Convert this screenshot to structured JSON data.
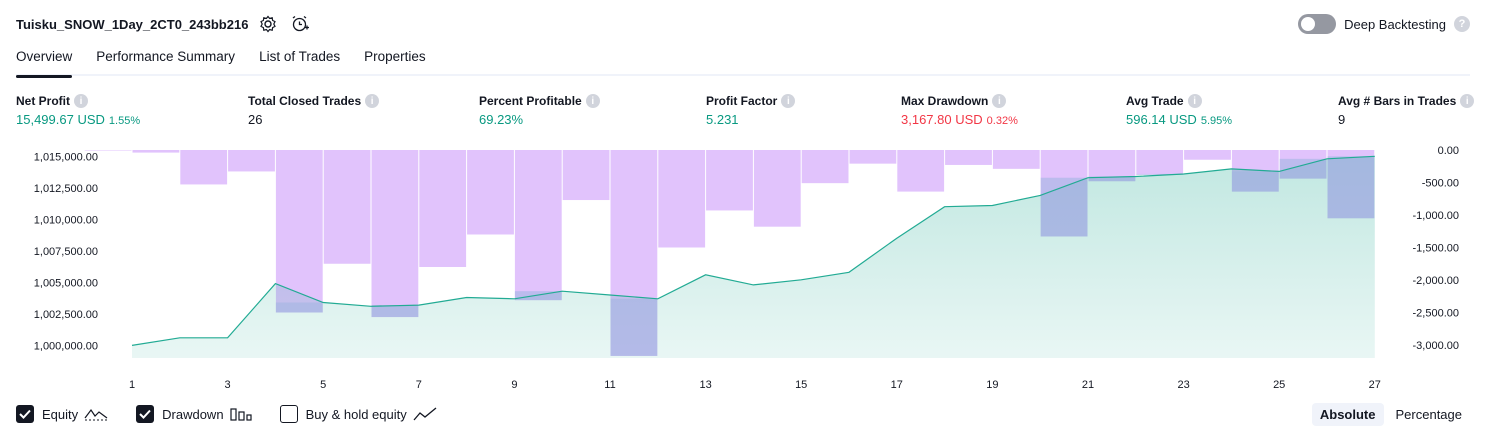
{
  "header": {
    "strategy_name": "Tuisku_SNOW_1Day_2CT0_243bb216",
    "deep_backtesting_label": "Deep Backtesting",
    "icons": [
      "settings-icon",
      "alert-add-icon",
      "help-icon"
    ]
  },
  "tabs": [
    {
      "label": "Overview",
      "active": true
    },
    {
      "label": "Performance Summary",
      "active": false
    },
    {
      "label": "List of Trades",
      "active": false
    },
    {
      "label": "Properties",
      "active": false
    }
  ],
  "metrics": [
    {
      "label": "Net Profit",
      "value": "15,499.67 USD",
      "pct": "1.55%",
      "tone": "pos"
    },
    {
      "label": "Total Closed Trades",
      "value": "26",
      "pct": "",
      "tone": "neutral"
    },
    {
      "label": "Percent Profitable",
      "value": "69.23%",
      "pct": "",
      "tone": "pos"
    },
    {
      "label": "Profit Factor",
      "value": "5.231",
      "pct": "",
      "tone": "pos"
    },
    {
      "label": "Max Drawdown",
      "value": "3,167.80 USD",
      "pct": "0.32%",
      "tone": "neg"
    },
    {
      "label": "Avg Trade",
      "value": "596.14 USD",
      "pct": "5.95%",
      "tone": "pos"
    },
    {
      "label": "Avg # Bars in Trades",
      "value": "9",
      "pct": "",
      "tone": "neutral"
    }
  ],
  "chart_data": {
    "type": "line",
    "x": [
      1,
      2,
      3,
      4,
      5,
      6,
      7,
      8,
      9,
      10,
      11,
      12,
      13,
      14,
      15,
      16,
      17,
      18,
      19,
      20,
      21,
      22,
      23,
      24,
      25,
      26,
      27
    ],
    "x_tick_labels": [
      "1",
      "3",
      "5",
      "7",
      "9",
      "11",
      "13",
      "15",
      "17",
      "19",
      "21",
      "23",
      "25",
      "27"
    ],
    "left_axis": {
      "range": [
        999000,
        1015500
      ],
      "tick_labels": [
        "1,015,000.00",
        "1,012,500.00",
        "1,010,000.00",
        "1,007,500.00",
        "1,005,000.00",
        "1,002,500.00",
        "1,000,000.00"
      ],
      "ticks": [
        1015000,
        1012500,
        1010000,
        1007500,
        1005000,
        1002500,
        1000000
      ]
    },
    "right_axis": {
      "range": [
        -3200,
        0
      ],
      "tick_labels": [
        "0.00",
        "-500.00",
        "-1,000.00",
        "-1,500.00",
        "-2,000.00",
        "-2,500.00",
        "-3,000.00"
      ],
      "ticks": [
        0,
        -500,
        -1000,
        -1500,
        -2000,
        -2500,
        -3000
      ]
    },
    "series": [
      {
        "name": "Equity",
        "kind": "area-line",
        "axis": "left",
        "color": "#22ab94",
        "values": [
          1000000,
          1000600,
          1000600,
          1004900,
          1003400,
          1003100,
          1003200,
          1003800,
          1003700,
          1004300,
          1004000,
          1003700,
          1005600,
          1004800,
          1005200,
          1005800,
          1008500,
          1011000,
          1011100,
          1011900,
          1013300,
          1013400,
          1013600,
          1014000,
          1013800,
          1014800,
          1015000
        ]
      },
      {
        "name": "Drawdown",
        "kind": "bar",
        "axis": "right",
        "color": "#e1c3fc",
        "values": [
          0,
          -40,
          -530,
          -330,
          -2500,
          -1750,
          -2570,
          -1800,
          -1300,
          -2310,
          -770,
          -3167.8,
          -1500,
          -930,
          -1180,
          -510,
          -210,
          -640,
          -230,
          -290,
          -1330,
          -480,
          -380,
          -150,
          -640,
          -440,
          -1050
        ]
      }
    ],
    "grid": false,
    "legend_position": "bottom-left"
  },
  "legend": {
    "items": [
      {
        "label": "Equity",
        "checked": true
      },
      {
        "label": "Drawdown",
        "checked": true
      },
      {
        "label": "Buy & hold equity",
        "checked": false
      }
    ],
    "scale_options": [
      {
        "label": "Absolute",
        "active": true
      },
      {
        "label": "Percentage",
        "active": false
      }
    ]
  }
}
